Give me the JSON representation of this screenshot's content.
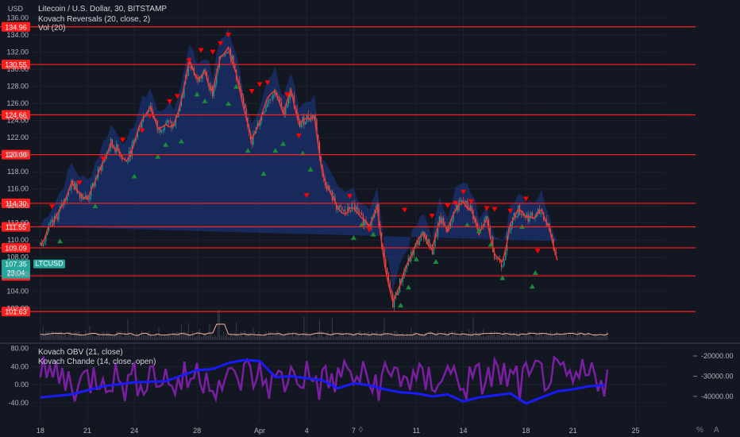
{
  "header": {
    "symbol_title": "Litecoin / U.S. Dollar, 30, BITSTAMP",
    "indicator_reversals": "Kovach Reversals (20, close, 2)",
    "indicator_vol": "Vol (20)",
    "indicator_obv": "Kovach OBV (21, close)",
    "indicator_chande": "Kovach Chande (14, close, open)"
  },
  "price_axis": {
    "currency": "USD",
    "ticks": [
      "136.00",
      "134.00",
      "132.00",
      "130.00",
      "128.00",
      "126.00",
      "124.00",
      "122.00",
      "120.00",
      "118.00",
      "116.00",
      "114.00",
      "112.00",
      "110.00",
      "108.00",
      "106.00",
      "104.00",
      "102.00"
    ],
    "tick_values": [
      136,
      134,
      132,
      130,
      128,
      126,
      124,
      122,
      120,
      118,
      116,
      114,
      112,
      110,
      108,
      106,
      104,
      102
    ],
    "range": [
      100.9,
      138.1
    ]
  },
  "levels": [
    {
      "label": "134.96",
      "value": 134.96
    },
    {
      "label": "130.55",
      "value": 130.55
    },
    {
      "label": "124.66",
      "value": 124.66
    },
    {
      "label": "120.00",
      "value": 120.0
    },
    {
      "label": "114.30",
      "value": 114.3
    },
    {
      "label": "111.55",
      "value": 111.55
    },
    {
      "label": "109.09",
      "value": 109.09
    },
    {
      "label": "105.81",
      "value": 105.81
    },
    {
      "label": "101.63",
      "value": 101.63
    }
  ],
  "last_price": {
    "ticker": "LTCUSD",
    "price": "107.35",
    "countdown": "23:04",
    "value": 107.35
  },
  "time_axis": {
    "ticks": [
      "18",
      "21",
      "24",
      "28",
      "Apr",
      "4",
      "7",
      "11",
      "14",
      "18",
      "21",
      "25"
    ],
    "tick_days": [
      0,
      3,
      6,
      10,
      14,
      17,
      20,
      24,
      27,
      31,
      34,
      38
    ],
    "range": [
      -0.55,
      39.9
    ]
  },
  "sub_axis_left": {
    "ticks": [
      "80.00",
      "40.00",
      "0.00",
      "-40.00"
    ],
    "values": [
      80,
      40,
      0,
      -40
    ],
    "range": [
      -84,
      88
    ]
  },
  "sub_axis_right": {
    "ticks": [
      "-20000.00",
      "-30000.00",
      "-40000.00"
    ],
    "values": [
      -20000,
      -30000,
      -40000
    ],
    "range": [
      -53000,
      -14500
    ]
  },
  "colors": {
    "background": "#131722",
    "grid": "#1e222d",
    "level_line": "#ff1f1f",
    "level_label_bg": "#ff1f1f",
    "last_price_bg": "#26a69a",
    "up_candle": "#26a69a",
    "down_candle": "#ef5350",
    "band": "#1c3a8a",
    "ma": "#e53935",
    "obv": "#1a1aff",
    "chande": "#7b1fa2",
    "volume_ma": "#f7b3a1"
  },
  "chart_data": {
    "type": "line",
    "x_unit": "day",
    "x": [
      0,
      0.5,
      1,
      1.5,
      2,
      2.5,
      3,
      3.5,
      4,
      4.5,
      5,
      5.5,
      6,
      6.5,
      7,
      7.5,
      8,
      8.5,
      9,
      9.5,
      10,
      10.5,
      11,
      11.5,
      12,
      12.5,
      13,
      13.5,
      14,
      14.5,
      15,
      15.5,
      16,
      16.5,
      17,
      17.5,
      18,
      18.5,
      19,
      19.5,
      20,
      20.5,
      21,
      21.5,
      22,
      22.5,
      23,
      23.5,
      24,
      24.5,
      25,
      25.5,
      26,
      26.5,
      27,
      27.5,
      28,
      28.5,
      29,
      29.5,
      30,
      30.5,
      31,
      31.5,
      32,
      32.5,
      33,
      33.5,
      34,
      34.5,
      35,
      35.5,
      36
    ],
    "series": [
      {
        "name": "LTCUSD",
        "values": [
          109.5,
          111.2,
          112.6,
          114.5,
          116.8,
          115.5,
          114.8,
          117,
          119.2,
          121.3,
          120.4,
          119,
          121.6,
          124.2,
          125.8,
          122.8,
          123.8,
          123.2,
          126.2,
          131.2,
          128.6,
          129.6,
          127.1,
          131.5,
          132.6,
          129.4,
          125.2,
          121.6,
          124,
          126.4,
          127.5,
          124.8,
          127.5,
          123.4,
          124.4,
          124.6,
          117.6,
          115.5,
          113.6,
          113.2,
          114,
          112.4,
          111.9,
          113.8,
          106.8,
          102.6,
          105.2,
          107.5,
          109.5,
          110.8,
          108.6,
          112.4,
          111.2,
          113.8,
          114.4,
          113.6,
          110.8,
          112.6,
          108.2,
          107.2,
          112,
          113.6,
          112.8,
          112.6,
          113.4,
          111.2,
          107.6
        ]
      }
    ],
    "reversal_tops": [
      [
        1.5,
        113.9
      ],
      [
        5,
        116.7
      ],
      [
        8,
        119.5
      ],
      [
        10.5,
        121.7
      ],
      [
        13,
        122.8
      ],
      [
        14,
        124.5
      ],
      [
        16.5,
        126.2
      ],
      [
        17.5,
        126.8
      ],
      [
        19,
        131
      ],
      [
        20.5,
        132.2
      ],
      [
        22,
        132
      ],
      [
        23,
        133
      ],
      [
        24,
        134
      ],
      [
        27,
        127.4
      ],
      [
        28,
        128.2
      ],
      [
        29,
        128.4
      ],
      [
        31.5,
        127
      ],
      [
        33,
        122.2
      ],
      [
        34,
        115.2
      ],
      [
        39.5,
        115.1
      ],
      [
        42,
        111.2
      ],
      [
        46.5,
        113.5
      ],
      [
        50,
        112.8
      ],
      [
        52,
        114
      ],
      [
        53,
        114.3
      ],
      [
        54,
        115.6
      ],
      [
        55,
        114.5
      ],
      [
        57,
        113.7
      ],
      [
        58,
        113.6
      ],
      [
        60,
        113.4
      ],
      [
        62,
        114.8
      ],
      [
        63.5,
        108.7
      ]
    ],
    "reversal_bottoms": [
      [
        2.5,
        109.9
      ],
      [
        7,
        114
      ],
      [
        12,
        117.5
      ],
      [
        15,
        119.8
      ],
      [
        16,
        121.2
      ],
      [
        18,
        121.6
      ],
      [
        20,
        127.1
      ],
      [
        21,
        126.3
      ],
      [
        24,
        126
      ],
      [
        25,
        128
      ],
      [
        26.5,
        120.5
      ],
      [
        28.5,
        117.8
      ],
      [
        30,
        120.5
      ],
      [
        31,
        121.3
      ],
      [
        33.5,
        120.2
      ],
      [
        34.5,
        118.3
      ],
      [
        40,
        110.3
      ],
      [
        41,
        111.8
      ],
      [
        42.5,
        110.7
      ],
      [
        46,
        102.4
      ],
      [
        47,
        104.5
      ],
      [
        48,
        107.8
      ],
      [
        50.5,
        107.5
      ],
      [
        54.5,
        111.8
      ],
      [
        56,
        111.1
      ],
      [
        57.5,
        109.5
      ],
      [
        59,
        105.6
      ],
      [
        61.5,
        111.6
      ],
      [
        62.8,
        104.6
      ],
      [
        63.2,
        106.2
      ]
    ]
  }
}
